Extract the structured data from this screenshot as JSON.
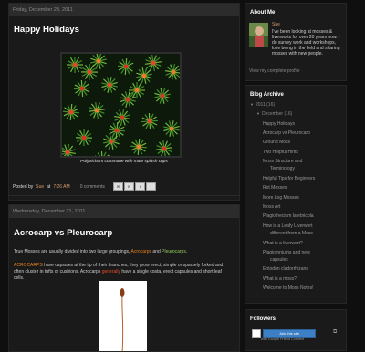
{
  "post1": {
    "date": "Friday, December 23, 2011",
    "title": "Happy Holidays",
    "caption_italic": "Polytrichum commune",
    "caption_rest": " with male splash cups",
    "posted_by_prefix": "Posted by",
    "author": "Sue",
    "at": "at",
    "time": "7:26 AM",
    "comments": "0 comments"
  },
  "post2": {
    "date": "Wednesday, December 21, 2011",
    "title": "Acrocarp vs Pleurocarp",
    "p1_text": "True Mosses are usually divided into two large groupings, ",
    "p1_acro": "Acrocarps",
    "p1_and": " and ",
    "p1_pleuro": "Pleurocarps",
    "p1_end": ".",
    "p2_acro": "ACROCARPS",
    "p2_text1": " have capsules at the tip of their branches, they grow erect, simple or sparsely forked and often cluster in tufts or cushions. Acrocarps ",
    "p2_generally": "generally",
    "p2_text2": " have a single costa, erect capsules and short leaf cells."
  },
  "about": {
    "heading": "About Me",
    "name": "Sue",
    "bio": "I've been looking at mosses & liverworts for over 20 years now. I do survey work and workshops, love being in the field and sharing mosses with new people.",
    "profile_link": "View my complete profile"
  },
  "archive": {
    "heading": "Blog Archive",
    "year": "2011",
    "year_count": "(16)",
    "month": "December",
    "month_count": "(16)",
    "posts": [
      "Happy Holidays",
      "Acrocarp vs Pleurocarp",
      "Ground Moss",
      "Two Helpful Hints",
      "Moss Structure and",
      "Terminology",
      "Helpful Tips for Beginners",
      "Rot Mosses",
      "More Log Mosses",
      "Moss Art",
      "Plagiothecium latebricola",
      "How is a Leafy Liverwort",
      "different from a Moss",
      "What is a liverwort?",
      "Plagiomniums and new",
      "capsules",
      "Entodon cladorrhizans",
      "What is a moss?",
      "Welcome to Moss Notes!"
    ]
  },
  "followers": {
    "heading": "Followers",
    "join_label": "Join this site",
    "sub": "with Google Friend Connect"
  },
  "share_icons": [
    "email-icon",
    "blog-this-icon",
    "twitter-icon",
    "facebook-icon"
  ]
}
